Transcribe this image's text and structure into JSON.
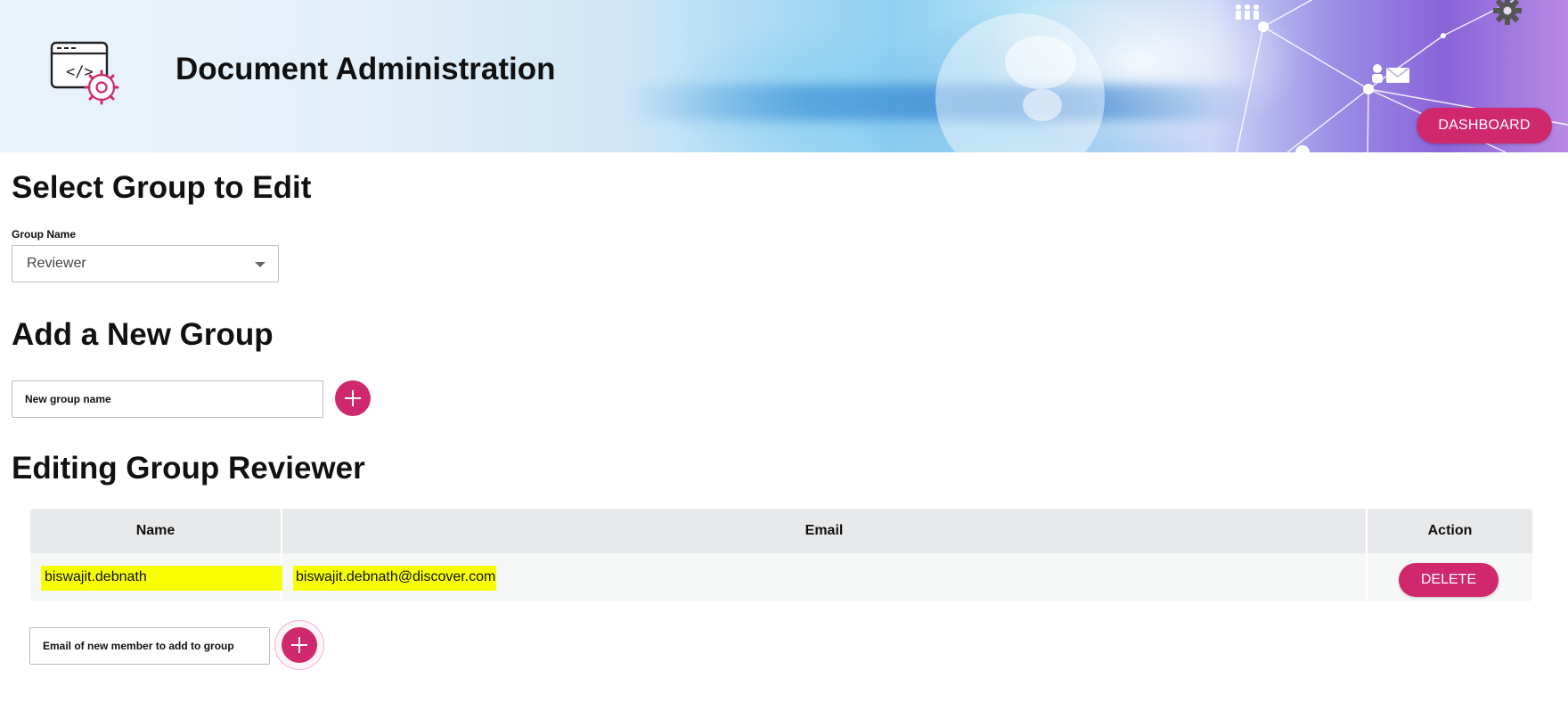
{
  "header": {
    "title": "Document Administration",
    "dashboard_label": "DASHBOARD",
    "app_icon": "code-window-gear-icon",
    "settings_icon": "gear-icon"
  },
  "select_group": {
    "heading": "Select Group to Edit",
    "field_label": "Group Name",
    "selected_value": "Reviewer"
  },
  "add_group": {
    "heading": "Add a New Group",
    "placeholder": "New group name",
    "add_icon": "plus-icon"
  },
  "editing_group": {
    "heading": "Editing Group Reviewer",
    "columns": [
      "Name",
      "Email",
      "Action"
    ],
    "rows": [
      {
        "name": "biswajit.debnath",
        "email": "biswajit.debnath@discover.com",
        "action_label": "DELETE"
      }
    ],
    "new_member_placeholder": "Email of new member to add to group",
    "add_icon": "plus-icon"
  },
  "colors": {
    "accent": "#d0286d",
    "highlight": "#f8ff00",
    "table_header": "#e7e9ea",
    "table_row": "#f6f7f7"
  }
}
